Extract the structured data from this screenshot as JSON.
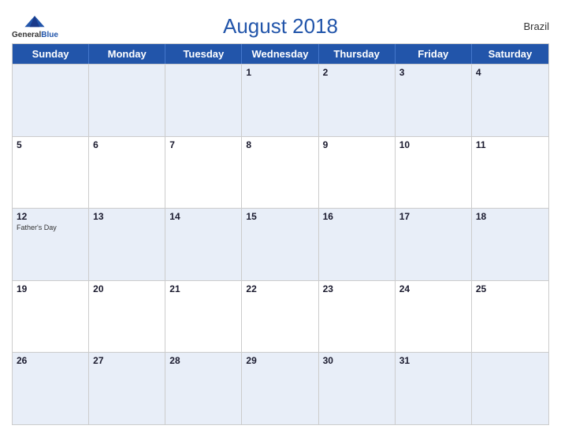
{
  "header": {
    "title": "August 2018",
    "country": "Brazil",
    "logo": {
      "line1": "General",
      "line2": "Blue"
    }
  },
  "days_of_week": [
    "Sunday",
    "Monday",
    "Tuesday",
    "Wednesday",
    "Thursday",
    "Friday",
    "Saturday"
  ],
  "weeks": [
    [
      {
        "date": "",
        "empty": true
      },
      {
        "date": "",
        "empty": true
      },
      {
        "date": "",
        "empty": true
      },
      {
        "date": "1",
        "empty": false
      },
      {
        "date": "2",
        "empty": false
      },
      {
        "date": "3",
        "empty": false
      },
      {
        "date": "4",
        "empty": false
      }
    ],
    [
      {
        "date": "5",
        "empty": false
      },
      {
        "date": "6",
        "empty": false
      },
      {
        "date": "7",
        "empty": false
      },
      {
        "date": "8",
        "empty": false
      },
      {
        "date": "9",
        "empty": false
      },
      {
        "date": "10",
        "empty": false
      },
      {
        "date": "11",
        "empty": false
      }
    ],
    [
      {
        "date": "12",
        "empty": false,
        "event": "Father's Day"
      },
      {
        "date": "13",
        "empty": false
      },
      {
        "date": "14",
        "empty": false
      },
      {
        "date": "15",
        "empty": false
      },
      {
        "date": "16",
        "empty": false
      },
      {
        "date": "17",
        "empty": false
      },
      {
        "date": "18",
        "empty": false
      }
    ],
    [
      {
        "date": "19",
        "empty": false
      },
      {
        "date": "20",
        "empty": false
      },
      {
        "date": "21",
        "empty": false
      },
      {
        "date": "22",
        "empty": false
      },
      {
        "date": "23",
        "empty": false
      },
      {
        "date": "24",
        "empty": false
      },
      {
        "date": "25",
        "empty": false
      }
    ],
    [
      {
        "date": "26",
        "empty": false
      },
      {
        "date": "27",
        "empty": false
      },
      {
        "date": "28",
        "empty": false
      },
      {
        "date": "29",
        "empty": false
      },
      {
        "date": "30",
        "empty": false
      },
      {
        "date": "31",
        "empty": false
      },
      {
        "date": "",
        "empty": true
      }
    ]
  ],
  "shaded_rows": [
    0,
    2,
    4
  ],
  "accent_color": "#2255aa"
}
